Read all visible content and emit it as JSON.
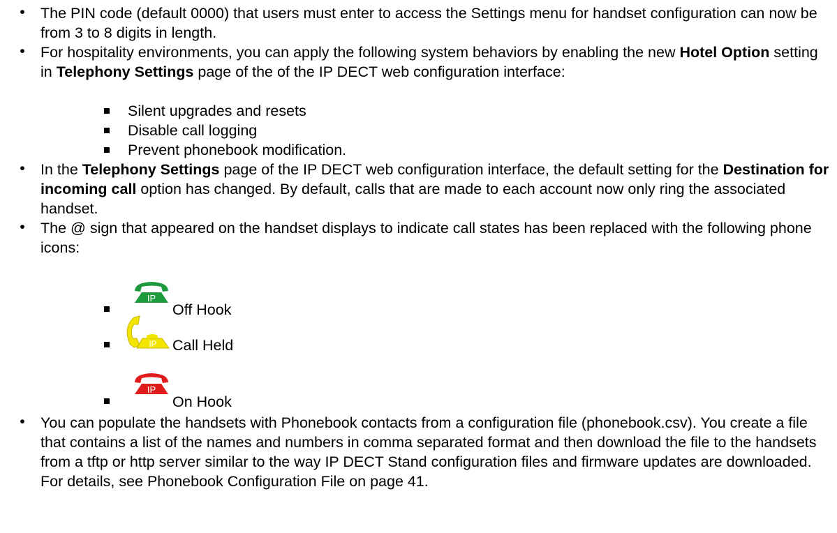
{
  "bullets": {
    "pin": "The PIN code (default 0000) that users must enter to access the Settings menu for handset configuration can now be from 3 to 8 digits in length.",
    "hotel": {
      "pre": "For hospitality environments, you can apply the following system behaviors by enabling the new ",
      "bold1": "Hotel Option",
      "mid": " setting in ",
      "bold2": "Telephony Settings",
      "post": " page of the of the IP DECT web configuration interface:",
      "subitems": [
        "Silent upgrades and resets",
        "Disable call logging",
        "Prevent phonebook modification."
      ]
    },
    "telephony": {
      "pre": "In the ",
      "bold1": "Telephony Settings",
      "mid": " page of the IP DECT web configuration interface, the default setting for the ",
      "bold2": "Destination for incoming call",
      "post": " option has changed. By default, calls that are made to each account now only ring the associated handset."
    },
    "icons_intro": "The @ sign that appeared on the handset displays to indicate call states has been replaced with the following phone icons:",
    "icons": [
      {
        "label": "Off Hook",
        "icon": "phone-ip-icon",
        "color": "#1e9a3c"
      },
      {
        "label": "Call Held",
        "icon": "phone-held-icon",
        "color": "#f2e600"
      },
      {
        "label": "On Hook",
        "icon": "phone-ip-icon",
        "color": "#e01b1b"
      }
    ],
    "phonebook": "You can populate the handsets with Phonebook contacts from a configuration file (phonebook.csv). You create a file that contains a list of the names and numbers in comma separated format and then download the file to the handsets from a tftp or http server similar to the way IP DECT Stand configuration files and firmware updates are downloaded. For details, see Phonebook Configuration File on page 41.",
    "icon_text": "IP"
  }
}
